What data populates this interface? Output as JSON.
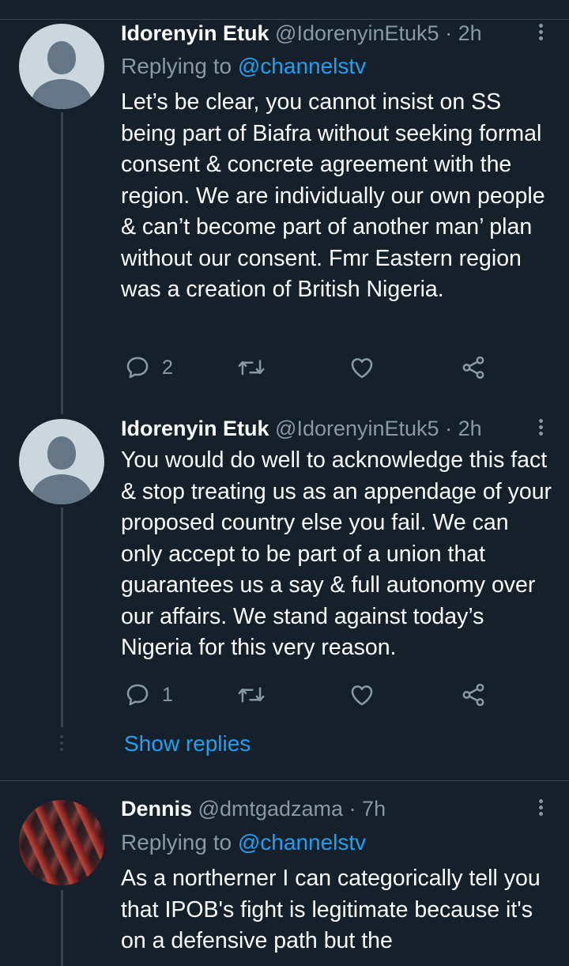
{
  "tweets": [
    {
      "name": "Idorenyin Etuk",
      "handle": "@IdorenyinEtuk5",
      "time": "· 2h",
      "reply_prefix": "Replying to",
      "reply_mention": "@channelstv",
      "text": "Let’s be clear, you cannot insist on SS being part of Biafra without seeking formal consent & concrete agreement with the region. We are individually our own people & can’t become part of another man’ plan without our consent. Fmr Eastern region was a creation of British Nigeria.",
      "reply_count": "2",
      "avatar_icon": "default-profile-icon"
    },
    {
      "name": "Idorenyin Etuk",
      "handle": "@IdorenyinEtuk5",
      "time": "· 2h",
      "text": "You would do well to acknowledge this fact & stop treating us as an appendage of your proposed country else you fail. We can only accept to be part of a union that guarantees us a say & full autonomy over our affairs. We stand against today’s Nigeria for this very reason.",
      "reply_count": "1",
      "avatar_icon": "default-profile-icon"
    },
    {
      "name": "Dennis",
      "handle": "@dmtgadzama",
      "time": "· 7h",
      "reply_prefix": "Replying to",
      "reply_mention": "@channelstv",
      "text": "As a northerner I can categorically tell you that IPOB's fight is legitimate because it's on a defensive path but the",
      "avatar_icon": "profile-photo"
    }
  ],
  "thread": {
    "show_replies_label": "Show replies"
  },
  "icons": {
    "reply": "reply-icon",
    "retweet": "retweet-icon",
    "like": "heart-icon",
    "share": "share-icon",
    "more": "more-vertical-icon"
  },
  "colors": {
    "background": "#15202b",
    "divider": "#38444d",
    "secondary_text": "#8899a6",
    "accent": "#1da1f2"
  }
}
